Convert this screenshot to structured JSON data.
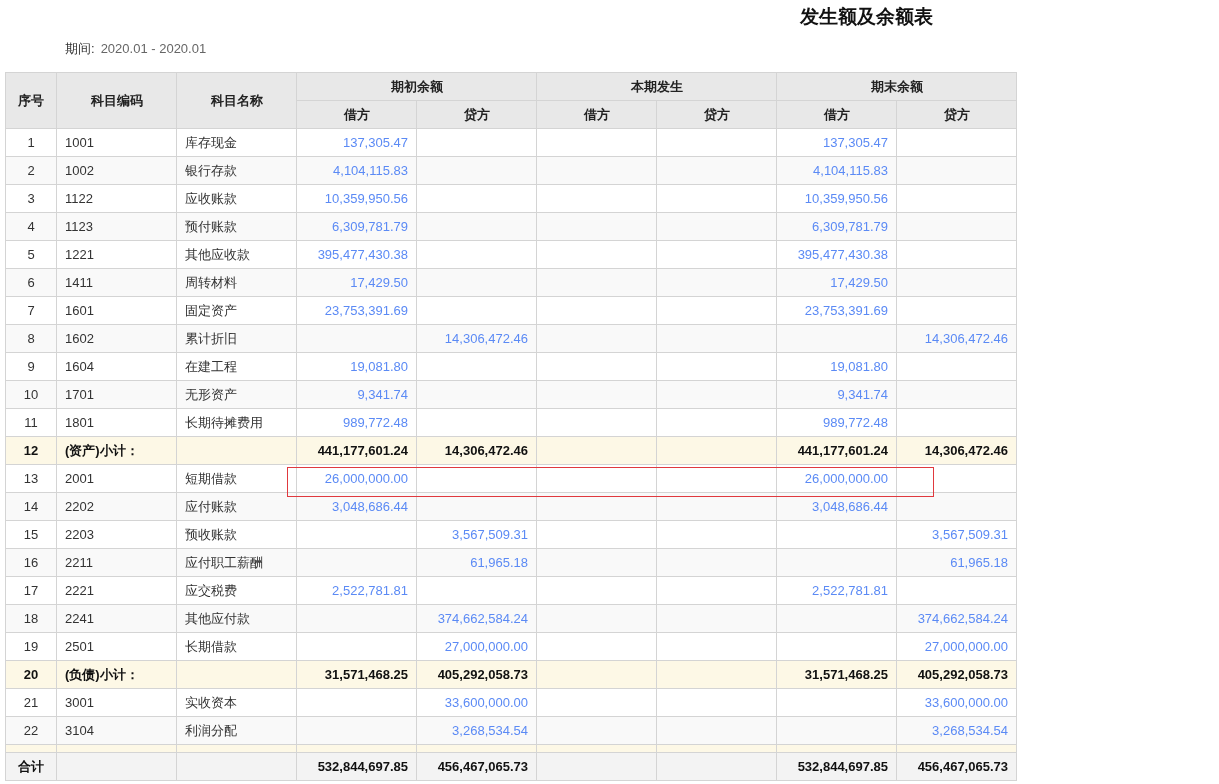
{
  "title": "发生额及余额表",
  "period": {
    "label": "期间:",
    "value": "2020.01 - 2020.01"
  },
  "columns": {
    "no": "序号",
    "code": "科目编码",
    "name": "科目名称",
    "groups": [
      "期初余额",
      "本期发生",
      "期末余额"
    ],
    "sub": [
      "借方",
      "贷方",
      "借方",
      "贷方",
      "借方",
      "贷方"
    ]
  },
  "rows": [
    {
      "no": "1",
      "code": "1001",
      "name": "库存现金",
      "kind": "item",
      "highlighted": false,
      "values": {
        "open_debit": "137,305.47",
        "close_debit": "137,305.47"
      }
    },
    {
      "no": "2",
      "code": "1002",
      "name": "银行存款",
      "kind": "item",
      "highlighted": false,
      "values": {
        "open_debit": "4,104,115.83",
        "close_debit": "4,104,115.83"
      }
    },
    {
      "no": "3",
      "code": "1122",
      "name": "应收账款",
      "kind": "item",
      "highlighted": false,
      "values": {
        "open_debit": "10,359,950.56",
        "close_debit": "10,359,950.56"
      }
    },
    {
      "no": "4",
      "code": "1123",
      "name": "预付账款",
      "kind": "item",
      "highlighted": false,
      "values": {
        "open_debit": "6,309,781.79",
        "close_debit": "6,309,781.79"
      }
    },
    {
      "no": "5",
      "code": "1221",
      "name": "其他应收款",
      "kind": "item",
      "highlighted": false,
      "values": {
        "open_debit": "395,477,430.38",
        "close_debit": "395,477,430.38"
      }
    },
    {
      "no": "6",
      "code": "1411",
      "name": "周转材料",
      "kind": "item",
      "highlighted": false,
      "values": {
        "open_debit": "17,429.50",
        "close_debit": "17,429.50"
      }
    },
    {
      "no": "7",
      "code": "1601",
      "name": "固定资产",
      "kind": "item",
      "highlighted": false,
      "values": {
        "open_debit": "23,753,391.69",
        "close_debit": "23,753,391.69"
      }
    },
    {
      "no": "8",
      "code": "1602",
      "name": "累计折旧",
      "kind": "item",
      "highlighted": false,
      "values": {
        "open_credit": "14,306,472.46",
        "close_credit": "14,306,472.46"
      }
    },
    {
      "no": "9",
      "code": "1604",
      "name": "在建工程",
      "kind": "item",
      "highlighted": false,
      "values": {
        "open_debit": "19,081.80",
        "close_debit": "19,081.80"
      }
    },
    {
      "no": "10",
      "code": "1701",
      "name": "无形资产",
      "kind": "item",
      "highlighted": false,
      "values": {
        "open_debit": "9,341.74",
        "close_debit": "9,341.74"
      }
    },
    {
      "no": "11",
      "code": "1801",
      "name": "长期待摊费用",
      "kind": "item",
      "highlighted": false,
      "values": {
        "open_debit": "989,772.48",
        "close_debit": "989,772.48"
      }
    },
    {
      "no": "12",
      "code": "(资产)小计：",
      "kind": "subtotal",
      "highlighted": false,
      "values": {
        "open_debit": "441,177,601.24",
        "open_credit": "14,306,472.46",
        "close_debit": "441,177,601.24",
        "close_credit": "14,306,472.46"
      }
    },
    {
      "no": "13",
      "code": "2001",
      "name": "短期借款",
      "kind": "item",
      "highlighted": true,
      "values": {
        "open_debit": "26,000,000.00",
        "close_debit": "26,000,000.00"
      }
    },
    {
      "no": "14",
      "code": "2202",
      "name": "应付账款",
      "kind": "item",
      "highlighted": false,
      "values": {
        "open_debit": "3,048,686.44",
        "close_debit": "3,048,686.44"
      }
    },
    {
      "no": "15",
      "code": "2203",
      "name": "预收账款",
      "kind": "item",
      "highlighted": false,
      "values": {
        "open_credit": "3,567,509.31",
        "close_credit": "3,567,509.31"
      }
    },
    {
      "no": "16",
      "code": "2211",
      "name": "应付职工薪酬",
      "kind": "item",
      "highlighted": false,
      "values": {
        "open_credit": "61,965.18",
        "close_credit": "61,965.18"
      }
    },
    {
      "no": "17",
      "code": "2221",
      "name": "应交税费",
      "kind": "item",
      "highlighted": false,
      "values": {
        "open_debit": "2,522,781.81",
        "close_debit": "2,522,781.81"
      }
    },
    {
      "no": "18",
      "code": "2241",
      "name": "其他应付款",
      "kind": "item",
      "highlighted": false,
      "values": {
        "open_credit": "374,662,584.24",
        "close_credit": "374,662,584.24"
      }
    },
    {
      "no": "19",
      "code": "2501",
      "name": "长期借款",
      "kind": "item",
      "highlighted": false,
      "values": {
        "open_credit": "27,000,000.00",
        "close_credit": "27,000,000.00"
      }
    },
    {
      "no": "20",
      "code": "(负债)小计：",
      "kind": "subtotal",
      "highlighted": false,
      "values": {
        "open_debit": "31,571,468.25",
        "open_credit": "405,292,058.73",
        "close_debit": "31,571,468.25",
        "close_credit": "405,292,058.73"
      }
    },
    {
      "no": "21",
      "code": "3001",
      "name": "实收资本",
      "kind": "item",
      "highlighted": false,
      "values": {
        "open_credit": "33,600,000.00",
        "close_credit": "33,600,000.00"
      }
    },
    {
      "no": "22",
      "code": "3104",
      "name": "利润分配",
      "kind": "item",
      "highlighted": false,
      "values": {
        "open_credit": "3,268,534.54",
        "close_credit": "3,268,534.54"
      }
    }
  ],
  "total": {
    "label": "合计",
    "values": {
      "open_debit": "532,844,697.85",
      "open_credit": "456,467,065.73",
      "close_debit": "532,844,697.85",
      "close_credit": "456,467,065.73"
    }
  }
}
